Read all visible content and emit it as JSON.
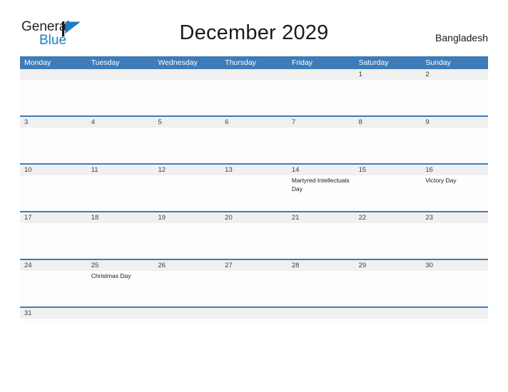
{
  "logo": {
    "word1": "General",
    "word2": "Blue",
    "icon": "flag-triangle-icon",
    "color_primary": "#231f20",
    "color_accent": "#1b7dc4"
  },
  "header": {
    "title": "December 2029",
    "country": "Bangladesh"
  },
  "colors": {
    "header_blue": "#3d7cb8",
    "row_rule": "#3d7cb8",
    "day_band": "#f0f0f0",
    "page_background": "#ffffff",
    "text": "#1a1a1a"
  },
  "calendar": {
    "weekdays": [
      "Monday",
      "Tuesday",
      "Wednesday",
      "Thursday",
      "Friday",
      "Saturday",
      "Sunday"
    ],
    "weeks": [
      {
        "short": false,
        "days": [
          {
            "num": "",
            "events": []
          },
          {
            "num": "",
            "events": []
          },
          {
            "num": "",
            "events": []
          },
          {
            "num": "",
            "events": []
          },
          {
            "num": "",
            "events": []
          },
          {
            "num": "1",
            "events": []
          },
          {
            "num": "2",
            "events": []
          }
        ]
      },
      {
        "short": false,
        "days": [
          {
            "num": "3",
            "events": []
          },
          {
            "num": "4",
            "events": []
          },
          {
            "num": "5",
            "events": []
          },
          {
            "num": "6",
            "events": []
          },
          {
            "num": "7",
            "events": []
          },
          {
            "num": "8",
            "events": []
          },
          {
            "num": "9",
            "events": []
          }
        ]
      },
      {
        "short": false,
        "days": [
          {
            "num": "10",
            "events": []
          },
          {
            "num": "11",
            "events": []
          },
          {
            "num": "12",
            "events": []
          },
          {
            "num": "13",
            "events": []
          },
          {
            "num": "14",
            "events": [
              "Martyred Intellectuals Day"
            ]
          },
          {
            "num": "15",
            "events": []
          },
          {
            "num": "16",
            "events": [
              "Victory Day"
            ]
          }
        ]
      },
      {
        "short": false,
        "days": [
          {
            "num": "17",
            "events": []
          },
          {
            "num": "18",
            "events": []
          },
          {
            "num": "19",
            "events": []
          },
          {
            "num": "20",
            "events": []
          },
          {
            "num": "21",
            "events": []
          },
          {
            "num": "22",
            "events": []
          },
          {
            "num": "23",
            "events": []
          }
        ]
      },
      {
        "short": false,
        "days": [
          {
            "num": "24",
            "events": []
          },
          {
            "num": "25",
            "events": [
              "Christmas Day"
            ]
          },
          {
            "num": "26",
            "events": []
          },
          {
            "num": "27",
            "events": []
          },
          {
            "num": "28",
            "events": []
          },
          {
            "num": "29",
            "events": []
          },
          {
            "num": "30",
            "events": []
          }
        ]
      },
      {
        "short": true,
        "days": [
          {
            "num": "31",
            "events": []
          },
          {
            "num": "",
            "events": []
          },
          {
            "num": "",
            "events": []
          },
          {
            "num": "",
            "events": []
          },
          {
            "num": "",
            "events": []
          },
          {
            "num": "",
            "events": []
          },
          {
            "num": "",
            "events": []
          }
        ]
      }
    ]
  }
}
